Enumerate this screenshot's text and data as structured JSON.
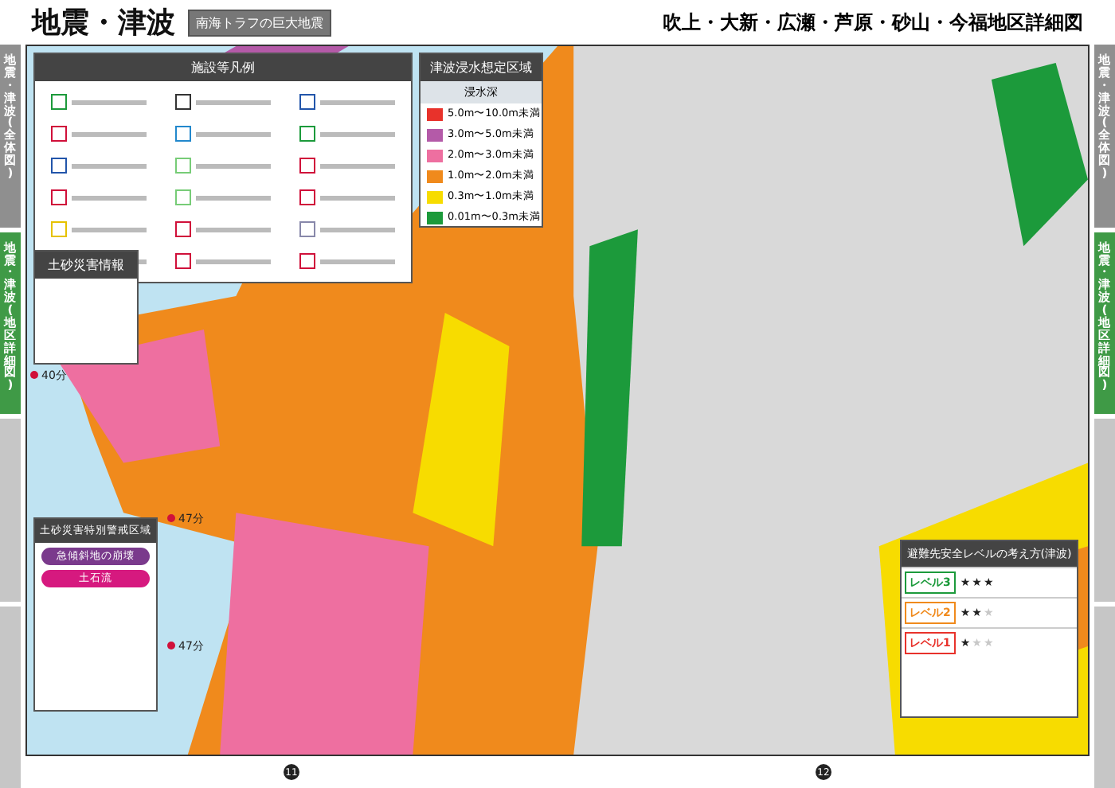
{
  "header": {
    "title": "地震・津波",
    "badge": "南海トラフの巨大地震",
    "district_title": "吹上・大新・広瀬・芦原・砂山・今福地区詳細図"
  },
  "left_tabs": [
    {
      "label": "地震・津波(全体図)",
      "selected": false
    },
    {
      "label": "地震・津波(地区詳細図)",
      "selected": true
    }
  ],
  "right_tabs": [
    {
      "label": "地震・津波(全体図)",
      "selected": false
    },
    {
      "label": "地震・津波(地区詳細図)",
      "selected": true
    }
  ],
  "facility_legend": {
    "title": "施設等凡例"
  },
  "inundation_legend": {
    "title": "津波浸水想定区域",
    "subtitle": "浸水深",
    "items": [
      {
        "label": "5.0m〜10.0m未満",
        "color": "#e8322b"
      },
      {
        "label": "3.0m〜5.0m未満",
        "color": "#b45aa8"
      },
      {
        "label": "2.0m〜3.0m未満",
        "color": "#ee6fa0"
      },
      {
        "label": "1.0m〜2.0m未満",
        "color": "#f08a1c"
      },
      {
        "label": "0.3m〜1.0m未満",
        "color": "#f7dc00"
      },
      {
        "label": "0.01m〜0.3m未満",
        "color": "#1c9a3b"
      }
    ]
  },
  "landslide_panel": {
    "title": "土砂災害情報"
  },
  "sediment_panel": {
    "title": "土砂災害特別警戒区域",
    "pills": [
      {
        "label": "急傾斜地の崩壊",
        "color": "#7a3a8c"
      },
      {
        "label": "土石流",
        "color": "#d6197f"
      }
    ]
  },
  "safety_panel": {
    "title": "避難先安全レベルの考え方(津波)",
    "levels": [
      {
        "label": "レベル3",
        "stars": 3,
        "color": "#1c9a3b"
      },
      {
        "label": "レベル2",
        "stars": 2,
        "color": "#f08a1c"
      },
      {
        "label": "レベル1",
        "stars": 1,
        "color": "#e8322b"
      }
    ]
  },
  "map_labels": [
    "40分",
    "47分",
    "47分"
  ],
  "page_numbers": [
    "11",
    "12"
  ]
}
